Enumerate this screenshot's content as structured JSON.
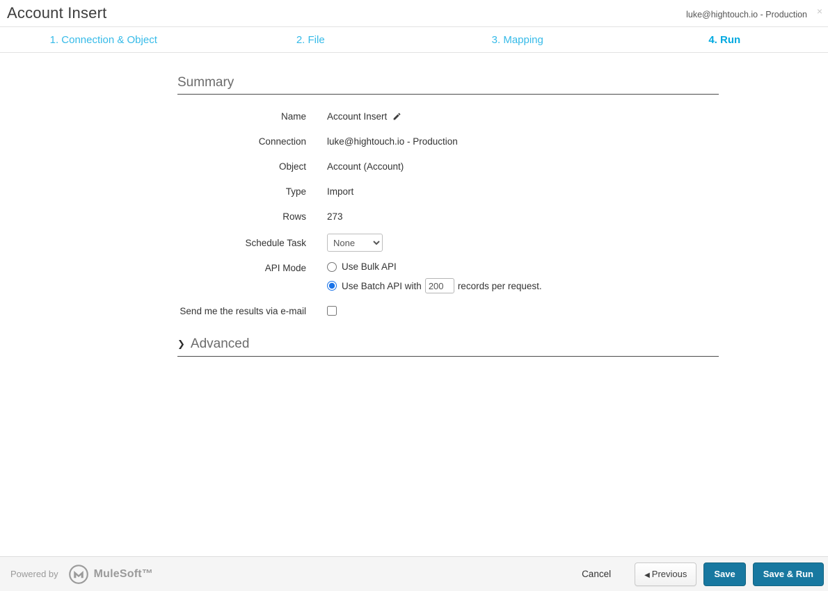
{
  "header": {
    "title": "Account Insert",
    "connection": "luke@hightouch.io - Production",
    "close_icon": "×"
  },
  "steps": [
    {
      "label": "1. Connection & Object",
      "active": false
    },
    {
      "label": "2. File",
      "active": false
    },
    {
      "label": "3. Mapping",
      "active": false
    },
    {
      "label": "4. Run",
      "active": true
    }
  ],
  "summary": {
    "heading": "Summary",
    "name_label": "Name",
    "name_value": "Account Insert",
    "connection_label": "Connection",
    "connection_value": "luke@hightouch.io - Production",
    "object_label": "Object",
    "object_value": "Account (Account)",
    "type_label": "Type",
    "type_value": "Import",
    "rows_label": "Rows",
    "rows_value": "273",
    "schedule_label": "Schedule Task",
    "schedule_value": "None",
    "api_mode_label": "API Mode",
    "bulk_api_label": "Use Bulk API",
    "batch_api_prefix": "Use Batch API with",
    "batch_size_value": "200",
    "batch_api_suffix": "records per request.",
    "email_label": "Send me the results via e-mail"
  },
  "advanced": {
    "chevron": "❯",
    "heading": "Advanced"
  },
  "footer": {
    "powered_by": "Powered by",
    "brand": "MuleSoft™",
    "cancel_label": "Cancel",
    "previous_icon": "◀",
    "previous_label": "Previous",
    "save_label": "Save",
    "save_run_label": "Save & Run"
  },
  "colors": {
    "step_inactive": "#35bae8",
    "step_active": "#00a9e0",
    "primary_button": "#1878a0",
    "radio_accent": "#1a73e8"
  }
}
